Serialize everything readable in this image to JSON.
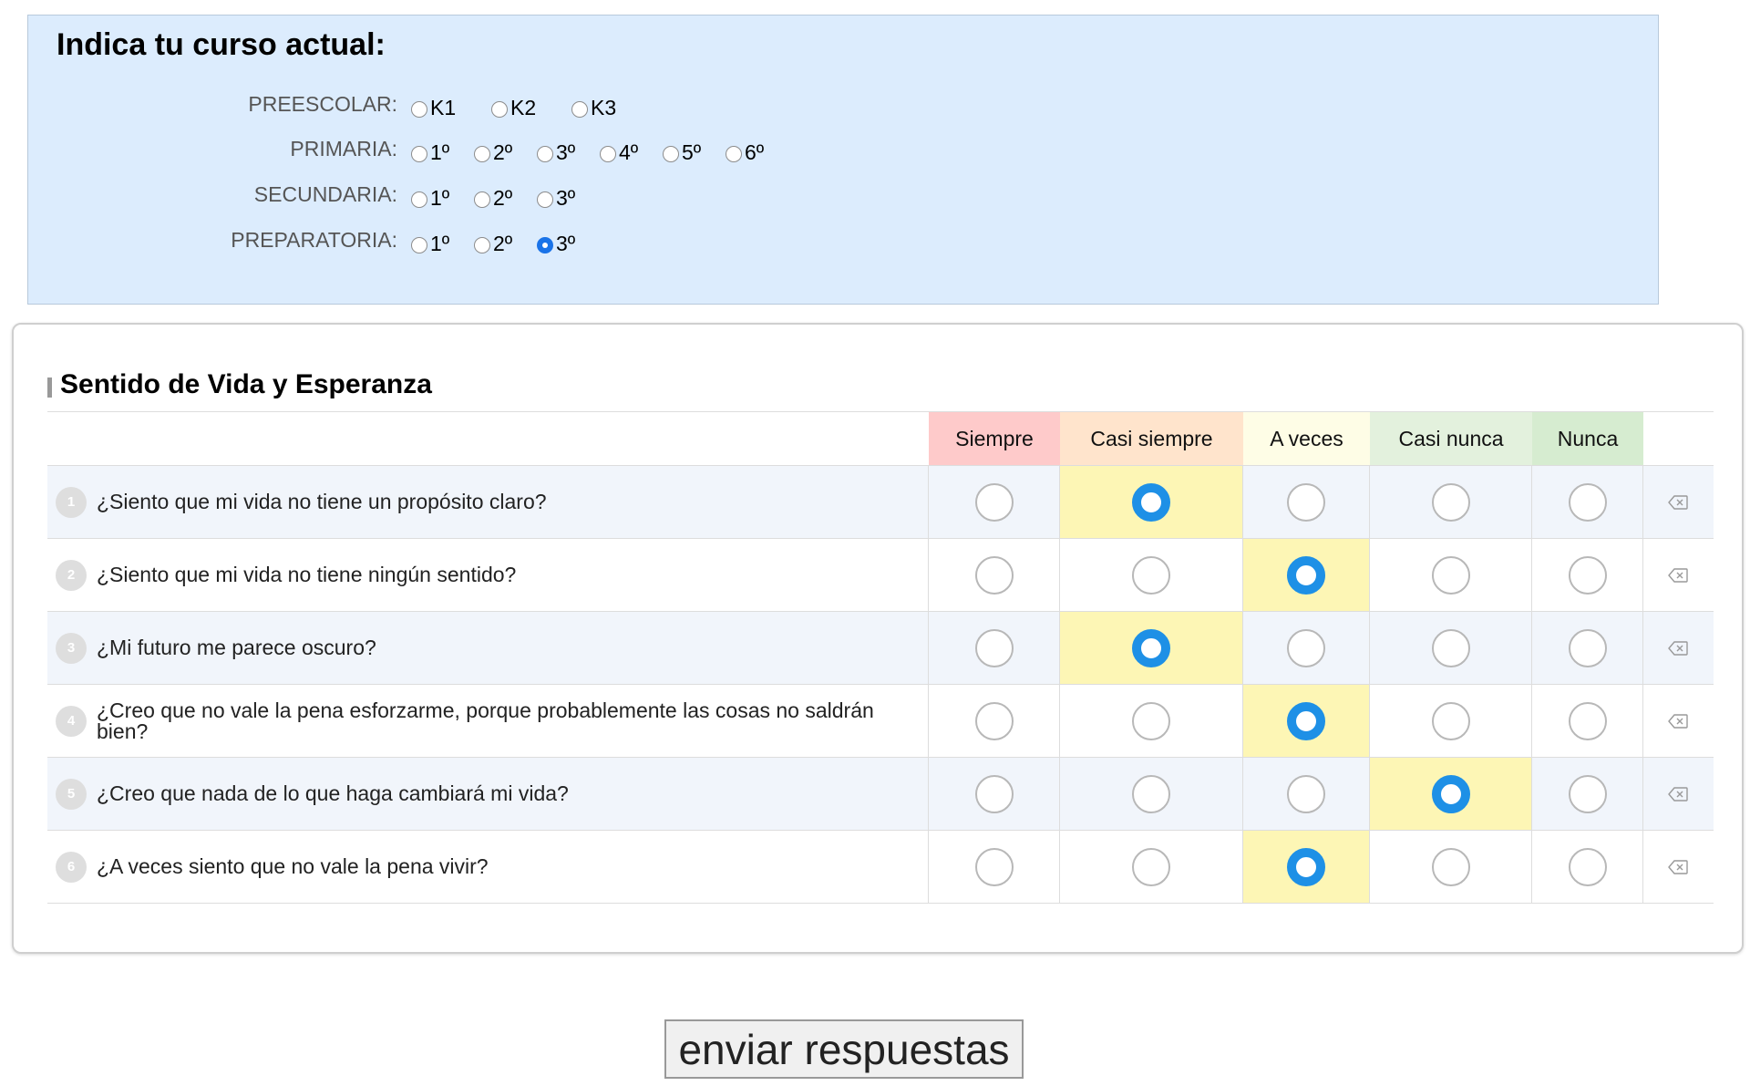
{
  "course": {
    "title": "Indica tu curso actual:",
    "levels": [
      {
        "label": "PREESCOLAR:",
        "options": [
          "K1",
          "K2",
          "K3"
        ],
        "selected": -1
      },
      {
        "label": "PRIMARIA:",
        "options": [
          "1º",
          "2º",
          "3º",
          "4º",
          "5º",
          "6º"
        ],
        "selected": -1
      },
      {
        "label": "SECUNDARIA:",
        "options": [
          "1º",
          "2º",
          "3º"
        ],
        "selected": -1
      },
      {
        "label": "PREPARATORIA:",
        "options": [
          "1º",
          "2º",
          "3º"
        ],
        "selected": 2
      }
    ]
  },
  "survey": {
    "title": "Sentido de Vida y Esperanza",
    "columns": [
      {
        "label": "Siempre",
        "color": "#fecaca"
      },
      {
        "label": "Casi siempre",
        "color": "#ffe4cc"
      },
      {
        "label": "A veces",
        "color": "#fefde6"
      },
      {
        "label": "Casi nunca",
        "color": "#e3f1dd"
      },
      {
        "label": "Nunca",
        "color": "#d6ecd0"
      }
    ],
    "questions": [
      {
        "num": "1",
        "text": "¿Siento que mi vida no tiene un propósito claro?",
        "selected": 1
      },
      {
        "num": "2",
        "text": "¿Siento que mi vida no tiene ningún sentido?",
        "selected": 2
      },
      {
        "num": "3",
        "text": "¿Mi futuro me parece oscuro?",
        "selected": 1
      },
      {
        "num": "4",
        "text": "¿Creo que no vale la pena esforzarme, porque probablemente las cosas no saldrán bien?",
        "selected": 2
      },
      {
        "num": "5",
        "text": "¿Creo que nada de lo que haga cambiará mi vida?",
        "selected": 3
      },
      {
        "num": "6",
        "text": "¿A veces siento que no vale la pena vivir?",
        "selected": 2
      }
    ],
    "clear_icon": "backspace-icon"
  },
  "submit": {
    "label": "enviar respuestas"
  }
}
